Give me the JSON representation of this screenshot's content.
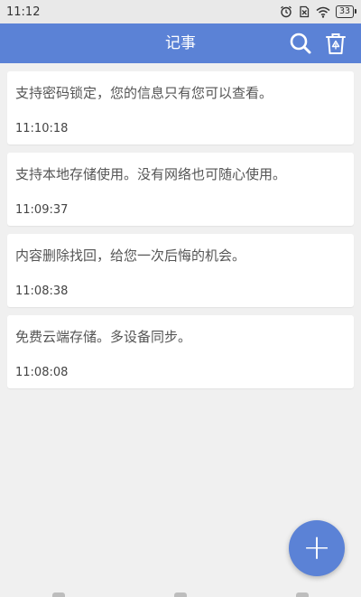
{
  "status_bar": {
    "time": "11:12",
    "battery": "33"
  },
  "app_bar": {
    "title": "记事"
  },
  "notes": [
    {
      "text": "支持密码锁定，您的信息只有您可以查看。",
      "time": "11:10:18"
    },
    {
      "text": "支持本地存储使用。没有网络也可随心使用。",
      "time": "11:09:37"
    },
    {
      "text": "内容删除找回，给您一次后悔的机会。",
      "time": "11:08:38"
    },
    {
      "text": "免费云端存储。多设备同步。",
      "time": "11:08:08"
    }
  ],
  "fab": {
    "glyph": "+"
  },
  "icons": {
    "alarm": "alarm-icon",
    "sim": "no-sim-icon",
    "wifi": "wifi-icon",
    "search": "search-icon",
    "trash": "recycle-bin-icon",
    "add": "plus-icon"
  },
  "colors": {
    "accent": "#5b82d6",
    "background": "#f0f0f0",
    "card": "#ffffff",
    "status_bar": "#e9e9e9"
  }
}
